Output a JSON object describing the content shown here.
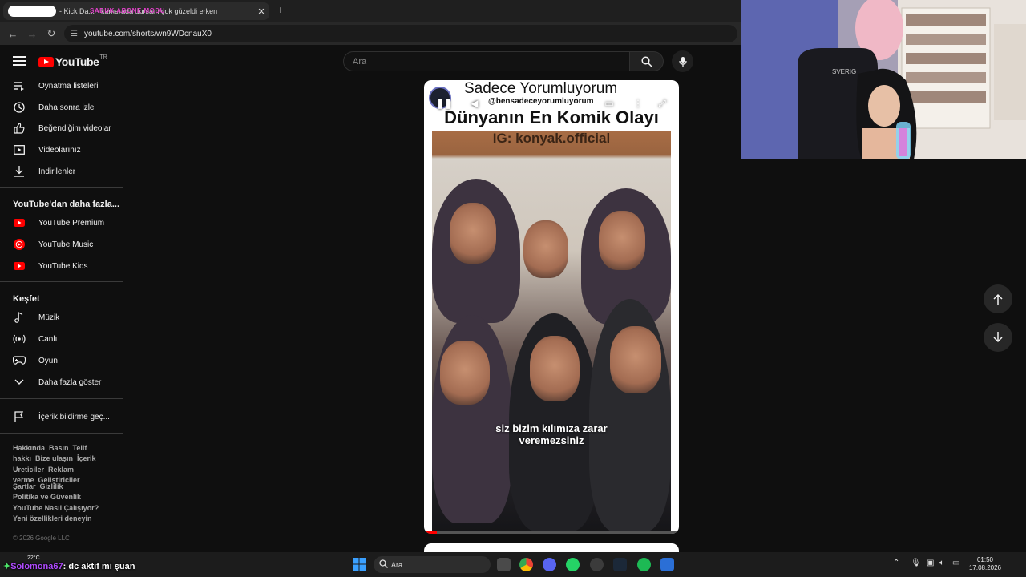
{
  "browser": {
    "tab_title": "- Kick Da... - kamerada dursam çok güzeldi erken",
    "tab_marquee": "SABUK ABONE MODU",
    "address": "youtube.com/shorts/wn9WDcnauX0"
  },
  "youtube": {
    "logo_text": "YouTube",
    "country_code": "TR",
    "search_placeholder": "Ara"
  },
  "sidebar": {
    "you_items": [
      {
        "label": "Oynatma listeleri",
        "icon": "playlist-icon"
      },
      {
        "label": "Daha sonra izle",
        "icon": "clock-icon"
      },
      {
        "label": "Beğendiğim videolar",
        "icon": "thumbs-up-icon"
      },
      {
        "label": "Videolarınız",
        "icon": "video-icon"
      },
      {
        "label": "İndirilenler",
        "icon": "download-icon"
      }
    ],
    "more_title": "YouTube'dan daha fazla...",
    "more_items": [
      {
        "label": "YouTube Premium",
        "icon": "youtube-premium-icon"
      },
      {
        "label": "YouTube Music",
        "icon": "youtube-music-icon"
      },
      {
        "label": "YouTube Kids",
        "icon": "youtube-kids-icon"
      }
    ],
    "explore_title": "Keşfet",
    "explore_items": [
      {
        "label": "Müzik",
        "icon": "music-note-icon"
      },
      {
        "label": "Canlı",
        "icon": "live-icon"
      },
      {
        "label": "Oyun",
        "icon": "gamepad-icon"
      },
      {
        "label": "Daha fazla göster",
        "icon": "chevron-down-icon"
      }
    ],
    "report_label": "İçerik bildirme geç...",
    "footer_links_1": [
      "Hakkında",
      "Basın",
      "Telif hakkı",
      "Bize ulaşın",
      "İçerik Üreticiler",
      "Reklam verme",
      "Geliştiriciler"
    ],
    "footer_links_2": [
      "Şartlar",
      "Gizlilik",
      "Politika ve Güvenlik",
      "YouTube Nasıl Çalışıyor?",
      "Yeni özellikleri deneyin"
    ],
    "copyright": "© 2026 Google LLC"
  },
  "short": {
    "channel_name": "Sadece Yorumluyorum",
    "channel_handle": "@bensadeceyorumluyorum",
    "headline": "Dünyanın En Komik Olayı",
    "watermark": "IG: konyak.official",
    "subtitle_line1": "siz bizim kılımıza zarar",
    "subtitle_line2": "veremezsiniz",
    "progress": 0.05
  },
  "chat": {
    "user": "Solomona67",
    "message": ": dc aktif mi şuan"
  },
  "taskbar": {
    "weather": "22°C",
    "search_label": "Ara",
    "time": "01:50",
    "date": "17.08.2026"
  },
  "colors": {
    "youtube_red": "#ff0000",
    "background": "#0f0f0f"
  }
}
